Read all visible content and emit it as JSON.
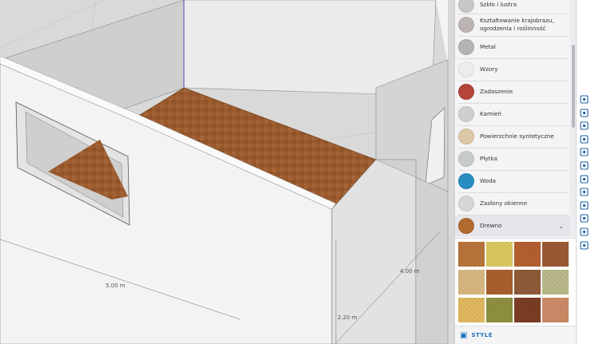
{
  "viewport": {
    "dimensions": [
      "5.00 m",
      "4.00 m",
      "2.20 m"
    ]
  },
  "materials": {
    "categories": [
      {
        "label": "Szkło i lustra",
        "icon": "glass-icon",
        "color": "#c7c7c7"
      },
      {
        "label": "Kształtowanie krajobrazu, ogrodzenia i roślinność",
        "icon": "landscape-icon",
        "color": "#bdb4b4"
      },
      {
        "label": "Metal",
        "icon": "metal-icon",
        "color": "#b4b4b6"
      },
      {
        "label": "Wzory",
        "icon": "patterns-icon",
        "color": "#ededed"
      },
      {
        "label": "Zadaszenie",
        "icon": "roofing-icon",
        "color": "#b5443a"
      },
      {
        "label": "Kamień",
        "icon": "stone-icon",
        "color": "#cfcfcf"
      },
      {
        "label": "Powierzchnie syntetyczne",
        "icon": "synthetic-icon",
        "color": "#dcc7a6"
      },
      {
        "label": "Płytka",
        "icon": "tile-icon",
        "color": "#c8ccc8"
      },
      {
        "label": "Woda",
        "icon": "water-icon",
        "color": "#2a8dbf"
      },
      {
        "label": "Zasłony okienne",
        "icon": "curtains-icon",
        "color": "#d6d6d8"
      },
      {
        "label": "Drewno",
        "icon": "wood-icon",
        "color": "#b06a2e"
      }
    ],
    "expanded": "Drewno",
    "textures": [
      "#b8743a",
      "#d9c860",
      "#b35f30",
      "#9a5a33",
      "#d8b680",
      "#a8602e",
      "#8e5a37",
      "#b8b88a",
      "#e0b860",
      "#8e9040",
      "#7a3d22",
      "#cc8a66"
    ]
  },
  "style_bar": {
    "label": "STYLE",
    "icon": "style-icon"
  },
  "rail": {
    "icons": [
      "entity-info-icon",
      "instructor-icon",
      "components-icon",
      "materials-icon",
      "styles-icon",
      "3d-warehouse-icon",
      "tags-icon",
      "scenes-icon",
      "outliner-icon",
      "display-icon",
      "info-icon",
      "report-icon"
    ]
  }
}
